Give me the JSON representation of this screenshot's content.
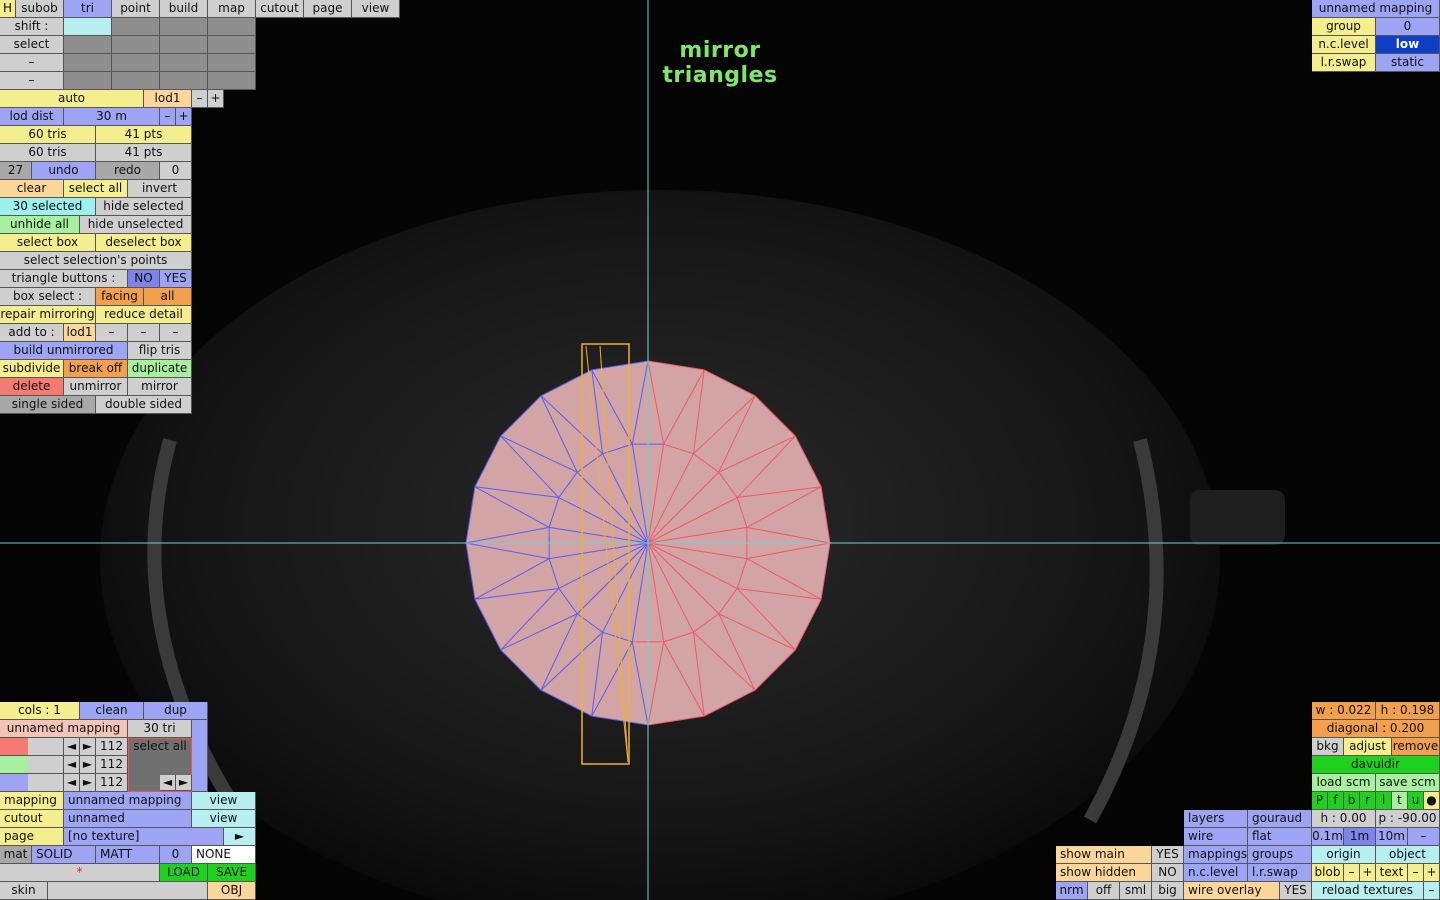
{
  "overlay_title": "mirror triangles",
  "colors": {
    "wire_blue": "#5a5ef0",
    "wire_red": "#f05a64",
    "guide": "#5fd8dc",
    "select_box": "#f0b030"
  },
  "menu": {
    "h": "H",
    "subob": "subob",
    "tri": "tri",
    "point": "point",
    "build": "build",
    "map": "map",
    "cutout": "cutout",
    "page": "page",
    "view": "view"
  },
  "modifiers": {
    "shift": "shift :",
    "select": "select",
    "dash": "–"
  },
  "lod": {
    "auto": "auto",
    "lod1": "lod1",
    "minus": "–",
    "plus": "+",
    "lod_dist": "lod dist",
    "dist_val": "30 m"
  },
  "stats": {
    "tris1": "60 tris",
    "pts1": "41 pts",
    "tris2": "60 tris",
    "pts2": "41 pts"
  },
  "history": {
    "count": "27",
    "undo": "undo",
    "redo": "redo",
    "redo_count": "0"
  },
  "tri_panel": {
    "clear": "clear",
    "select_all": "select all",
    "invert": "invert",
    "selected": "30 selected",
    "hide_selected": "hide selected",
    "unhide_all": "unhide all",
    "hide_unselected": "hide unselected",
    "select_box": "select box",
    "deselect_box": "deselect box",
    "select_points": "select selection's points",
    "triangle_buttons": "triangle buttons :",
    "no": "NO",
    "yes": "YES",
    "box_select": "box select :",
    "facing": "facing",
    "all": "all",
    "repair_mirroring": "repair mirroring",
    "reduce_detail": "reduce detail",
    "add_to": "add to :",
    "add_lod": "lod1",
    "dash": "–",
    "build_unmirrored": "build unmirrored",
    "flip_tris": "flip tris",
    "subdivide": "subdivide",
    "break_off": "break off",
    "duplicate": "duplicate",
    "delete": "delete",
    "unmirror": "unmirror",
    "mirror": "mirror",
    "single_sided": "single sided",
    "double_sided": "double sided"
  },
  "mapping_panel": {
    "name": "unnamed mapping",
    "group": "group",
    "group_val": "0",
    "nc_level": "n.c.level",
    "nc_val": "low",
    "lr_swap": "l.r.swap",
    "lr_val": "static"
  },
  "bottom_left": {
    "cols": "cols : 1",
    "clean": "clean",
    "dup": "dup",
    "mapping_name": "unnamed mapping",
    "tri_count": "30 tri",
    "rgb": [
      "112",
      "112",
      "112"
    ],
    "select_all": "select all",
    "arrow_left": "◄",
    "arrow_right": "►",
    "mapping": "mapping",
    "mapping_val": "unnamed mapping",
    "view": "view",
    "cutout": "cutout",
    "cutout_val": "unnamed",
    "page": "page",
    "page_val": "[no texture]",
    "play": "►",
    "mat": "mat",
    "solid": "SOLID",
    "matt": "MATT",
    "mat_num": "0",
    "none": "NONE",
    "star": "*",
    "load": "LOAD",
    "save": "SAVE",
    "skin": "skin",
    "obj": "OBJ"
  },
  "bottom_right": {
    "w": "w : 0.022",
    "h": "h : 0.198",
    "diagonal": "diagonal : 0.200",
    "bkg": "bkg",
    "adjust": "adjust",
    "remove": "remove",
    "davuldir": "davuldir",
    "load_scm": "load scm",
    "save_scm": "save scm",
    "views": [
      "P",
      "f",
      "b",
      "r",
      "l",
      "t",
      "u",
      "●"
    ],
    "layers": "layers",
    "gouraud": "gouraud",
    "hval": "h : 0.00",
    "pval": "p : -90.00",
    "wire": "wire",
    "flat": "flat",
    "s01": "0.1m",
    "s1": "1m",
    "s10": "10m",
    "dash": "–",
    "show_main": "show main",
    "yes": "YES",
    "mappings": "mappings",
    "groups": "groups",
    "origin": "origin",
    "object": "object",
    "show_hidden": "show hidden",
    "no": "NO",
    "nc_level": "n.c.level",
    "lr_swap": "l.r.swap",
    "blob": "blob",
    "minus": "–",
    "plus": "+",
    "text": "text",
    "nrm": "nrm",
    "off": "off",
    "sml": "sml",
    "big": "big",
    "wire_overlay": "wire overlay",
    "reload_textures": "reload textures"
  }
}
